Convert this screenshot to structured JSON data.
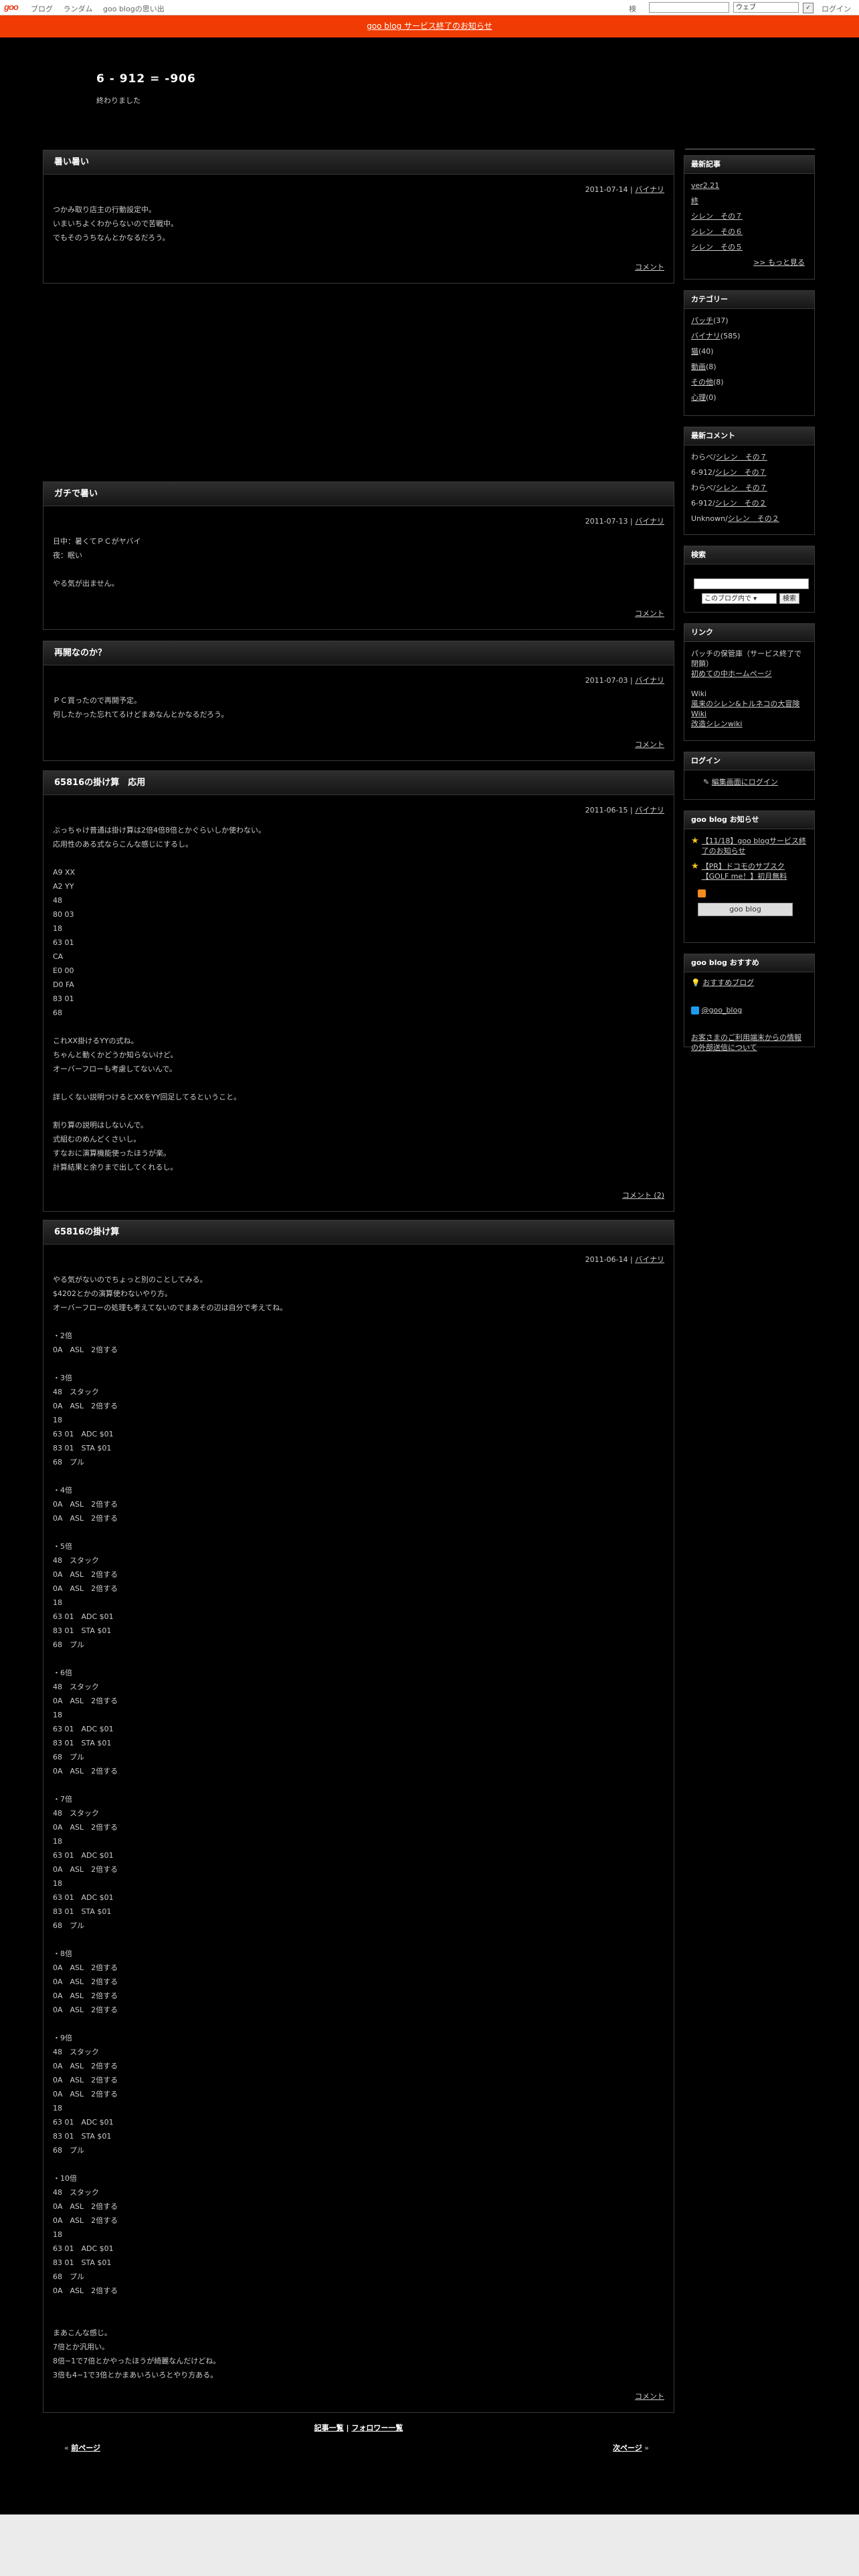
{
  "topbar": {
    "logo": "goo",
    "nav": [
      "ブログ",
      "ランダム",
      "goo blogの思い出"
    ],
    "search_label": "検索",
    "search_scope": "ウェブ",
    "login": "ログイン"
  },
  "notice": "goo blog サービス終了のお知らせ",
  "blog": {
    "title": "6 - 912 = -906",
    "description": "終わりました"
  },
  "entries": [
    {
      "title": "暑い暑い",
      "date": "2011-07-14",
      "category": "バイナリ",
      "body": "つかみ取り店主の行動設定中。\nいまいちよくわからないので苦戦中。\nでもそのうちなんとかなるだろう。",
      "footer": "コメント"
    },
    {
      "title": "ガチで暑い",
      "date": "2011-07-13",
      "category": "バイナリ",
      "body": "日中：暑くてＰＣがヤバイ\n夜：眠い\n\nやる気が出ません。",
      "footer": "コメント"
    },
    {
      "title": "再開なのか？",
      "date": "2011-07-03",
      "category": "バイナリ",
      "body": "ＰＣ買ったので再開予定。\n何したかった忘れてるけどまあなんとかなるだろう。",
      "footer": "コメント"
    },
    {
      "title": "65816の掛け算　応用",
      "date": "2011-06-15",
      "category": "バイナリ",
      "body": "ぶっちゃけ普通は掛け算は2倍4倍8倍とかぐらいしか使わない。\n応用性のある式ならこんな感じにするし。\n\nA9 XX\nA2 YY\n48\n80 03\n18\n63 01\nCA\nE0 00\nD0 FA\n83 01\n68\n\nこれXX掛けるYYの式ね。\nちゃんと動くかどうか知らないけど。\nオーバーフローも考慮してないんで。\n\n詳しくない説明つけるとXXをYY回足してるということ。\n\n割り算の説明はしないんで。\n式組むのめんどくさいし。\nすなおに演算機能使ったほうが楽。\n計算結果と余りまで出してくれるし。",
      "footer": "コメント (2)"
    },
    {
      "title": "65816の掛け算",
      "date": "2011-06-14",
      "category": "バイナリ",
      "body": "やる気がないのでちょっと別のことしてみる。\n$4202とかの演算使わないやり方。\nオーバーフローの処理も考えてないのでまあその辺は自分で考えてね。\n\n・2倍\n0A　ASL　2倍する\n\n・3倍\n48　スタック\n0A　ASL　2倍する\n18\n63 01　ADC $01\n83 01　STA $01\n68　プル\n\n・4倍\n0A　ASL　2倍する\n0A　ASL　2倍する\n\n・5倍\n48　スタック\n0A　ASL　2倍する\n0A　ASL　2倍する\n18\n63 01　ADC $01\n83 01　STA $01\n68　プル\n\n・6倍\n48　スタック\n0A　ASL　2倍する\n18\n63 01　ADC $01\n83 01　STA $01\n68　プル\n0A　ASL　2倍する\n\n・7倍\n48　スタック\n0A　ASL　2倍する\n18\n63 01　ADC $01\n0A　ASL　2倍する\n18\n63 01　ADC $01\n83 01　STA $01\n68　プル\n\n・8倍\n0A　ASL　2倍する\n0A　ASL　2倍する\n0A　ASL　2倍する\n0A　ASL　2倍する\n\n・9倍\n48　スタック\n0A　ASL　2倍する\n0A　ASL　2倍する\n0A　ASL　2倍する\n18\n63 01　ADC $01\n83 01　STA $01\n68　プル\n\n・10倍\n48　スタック\n0A　ASL　2倍する\n0A　ASL　2倍する\n18\n63 01　ADC $01\n83 01　STA $01\n68　プル\n0A　ASL　2倍する\n\n\nまあこんな感じ。\n7倍とか汎用い。\n8倍−1で7倍とかやったほうが綺麗なんだけどね。\n3倍も4−1で3倍とかまあいろいろとやり方ある。",
      "footer": "コメント"
    }
  ],
  "sidebar": {
    "recent": {
      "heading": "最新記事",
      "items": [
        "ver2.21",
        "終",
        "シレン　その７",
        "シレン　その６",
        "シレン　その５"
      ],
      "more": ">> もっと見る"
    },
    "category": {
      "heading": "カテゴリー",
      "items": [
        {
          "name": "パッチ",
          "count": "(37)"
        },
        {
          "name": "バイナリ",
          "count": "(585)"
        },
        {
          "name": "猫",
          "count": "(40)"
        },
        {
          "name": "動画",
          "count": "(8)"
        },
        {
          "name": "その他",
          "count": "(8)"
        },
        {
          "name": "心理",
          "count": "(0)"
        }
      ]
    },
    "comments": {
      "heading": "最新コメント",
      "items": [
        {
          "who": "わらべ/",
          "link": "シレン　その７"
        },
        {
          "who": "6-912/",
          "link": "シレン　その７"
        },
        {
          "who": "わらべ/",
          "link": "シレン　その７"
        },
        {
          "who": "6-912/",
          "link": "シレン　その２"
        },
        {
          "who": "Unknown/",
          "link": "シレン　その２"
        }
      ]
    },
    "search": {
      "heading": "検索",
      "scope": "このブログ内で",
      "button": "検索"
    },
    "links": {
      "heading": "リンク",
      "items": [
        "パッチの保管庫（サービス終了で閉鎖）",
        "初めての中ホームページ",
        "",
        "Wiki",
        "風来のシレン&トルネコの大冒険 Wiki",
        "改造シレンwiki"
      ]
    },
    "login": {
      "heading": "ログイン",
      "link": "編集画面にログイン"
    },
    "news": {
      "heading": "goo blog お知らせ",
      "items": [
        "【11/18】goo blogサービス終了のお知らせ",
        "【PR】ドコモのサブスク【GOLF me！】初月無料"
      ],
      "badge": "goo blog"
    },
    "recommend": {
      "heading": "goo blog おすすめ",
      "item": "おすすめブログ",
      "twitter": "@goo_blog",
      "notice": "お客さまのご利用端末からの情報の外部送信について"
    }
  },
  "footer": {
    "list": "記事一覧",
    "follow": "フォロワー一覧",
    "prev": "前ページ",
    "next": "次ページ"
  }
}
